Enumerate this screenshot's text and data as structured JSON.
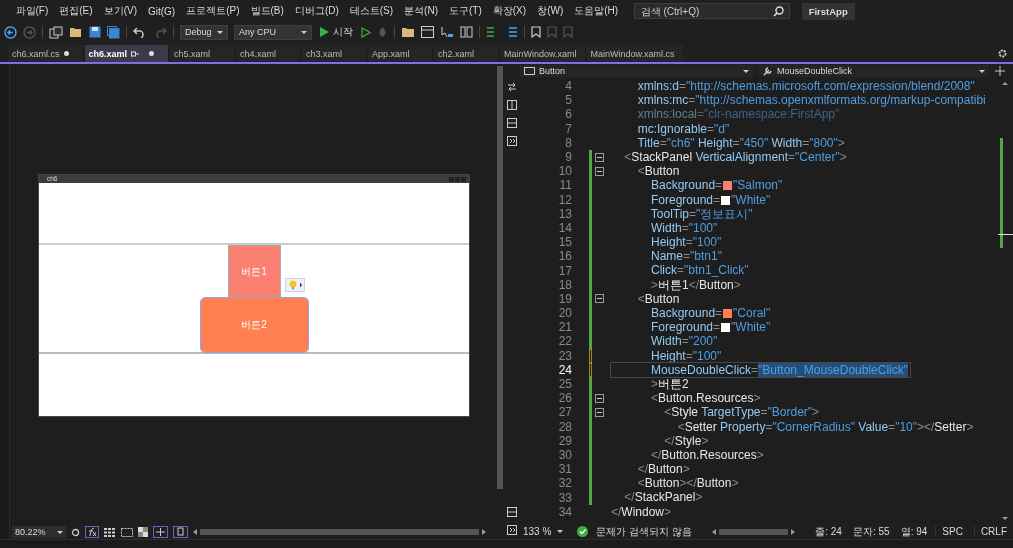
{
  "menu": [
    {
      "label": "파일(F)"
    },
    {
      "label": "편집(E)"
    },
    {
      "label": "보기(V)"
    },
    {
      "label": "Git(G)"
    },
    {
      "label": "프로젝트(P)"
    },
    {
      "label": "빌드(B)"
    },
    {
      "label": "디버그(D)"
    },
    {
      "label": "테스트(S)"
    },
    {
      "label": "분석(N)"
    },
    {
      "label": "도구(T)"
    },
    {
      "label": "확장(X)"
    },
    {
      "label": "창(W)"
    },
    {
      "label": "도움말(H)"
    }
  ],
  "search": {
    "placeholder": "검색 (Ctrl+Q)"
  },
  "solution_name": "FirstApp",
  "toolbar": {
    "configuration": "Debug",
    "platform": "Any CPU",
    "start": "시작"
  },
  "tabs": [
    {
      "label": "ch6.xaml.cs",
      "selected": false,
      "modified": true,
      "pinned": false
    },
    {
      "label": "ch6.xaml",
      "selected": true,
      "modified": true,
      "pinned": true
    },
    {
      "label": "ch5.xaml",
      "selected": false,
      "modified": false,
      "pinned": false
    },
    {
      "label": "ch4.xaml",
      "selected": false,
      "modified": false,
      "pinned": false
    },
    {
      "label": "ch3.xaml",
      "selected": false,
      "modified": false,
      "pinned": false
    },
    {
      "label": "App.xaml",
      "selected": false,
      "modified": false,
      "pinned": false
    },
    {
      "label": "ch2.xaml",
      "selected": false,
      "modified": false,
      "pinned": false
    },
    {
      "label": "MainWindow.xaml",
      "selected": false,
      "modified": false,
      "pinned": false
    },
    {
      "label": "MainWindow.xaml.cs",
      "selected": false,
      "modified": false,
      "pinned": false
    }
  ],
  "designer": {
    "window_title": "ch6",
    "buttons": [
      {
        "label": "버튼1",
        "color": "#fa8072",
        "selected": false
      },
      {
        "label": "버튼2",
        "color": "#ff7f50",
        "selected": true
      }
    ],
    "zoom": "80.22%"
  },
  "editor": {
    "element": "Button",
    "member": "MouseDoubleClick",
    "lines": [
      {
        "num": "4",
        "modified": false,
        "fold": false,
        "current": false,
        "dim": false,
        "tokens": [
          {
            "kind": "attr",
            "text": "        xmlns:d"
          },
          {
            "kind": "punct",
            "text": "="
          },
          {
            "kind": "value",
            "text": "\"http://schemas.microsoft.com/expression/blend/2008\""
          }
        ]
      },
      {
        "num": "5",
        "modified": false,
        "fold": false,
        "current": false,
        "dim": false,
        "tokens": [
          {
            "kind": "attr",
            "text": "        xmlns:mc"
          },
          {
            "kind": "punct",
            "text": "="
          },
          {
            "kind": "value",
            "text": "\"http://schemas.openxmlformats.org/markup-compatibi"
          }
        ]
      },
      {
        "num": "6",
        "modified": false,
        "fold": false,
        "current": false,
        "dim": true,
        "tokens": [
          {
            "kind": "attr",
            "text": "        xmlns:local"
          },
          {
            "kind": "punct",
            "text": "="
          },
          {
            "kind": "value",
            "text": "\"clr-namespace:FirstApp\""
          }
        ]
      },
      {
        "num": "7",
        "modified": false,
        "fold": false,
        "current": false,
        "dim": false,
        "tokens": [
          {
            "kind": "attr",
            "text": "        mc:Ignorable"
          },
          {
            "kind": "punct",
            "text": "="
          },
          {
            "kind": "value",
            "text": "\"d\""
          }
        ]
      },
      {
        "num": "8",
        "modified": false,
        "fold": false,
        "current": false,
        "dim": false,
        "tokens": [
          {
            "kind": "attr",
            "text": "        Title"
          },
          {
            "kind": "punct",
            "text": "="
          },
          {
            "kind": "value",
            "text": "\"ch6\""
          },
          {
            "kind": "attr",
            "text": " Height"
          },
          {
            "kind": "punct",
            "text": "="
          },
          {
            "kind": "value",
            "text": "\"450\""
          },
          {
            "kind": "attr",
            "text": " Width"
          },
          {
            "kind": "punct",
            "text": "="
          },
          {
            "kind": "value",
            "text": "\"800\""
          },
          {
            "kind": "punct",
            "text": ">"
          }
        ]
      },
      {
        "num": "9",
        "modified": true,
        "saved": true,
        "fold": true,
        "current": false,
        "dim": false,
        "tokens": [
          {
            "kind": "punct",
            "text": "    <"
          },
          {
            "kind": "tag",
            "text": "StackPanel"
          },
          {
            "kind": "attr",
            "text": " VerticalAlignment"
          },
          {
            "kind": "punct",
            "text": "="
          },
          {
            "kind": "value",
            "text": "\"Center\""
          },
          {
            "kind": "punct",
            "text": ">"
          }
        ]
      },
      {
        "num": "10",
        "modified": true,
        "saved": true,
        "fold": true,
        "current": false,
        "dim": false,
        "tokens": [
          {
            "kind": "punct",
            "text": "        <"
          },
          {
            "kind": "tag",
            "text": "Button"
          }
        ]
      },
      {
        "num": "11",
        "modified": true,
        "saved": true,
        "fold": false,
        "current": false,
        "dim": false,
        "tokens": [
          {
            "kind": "attr",
            "text": "            Background"
          },
          {
            "kind": "punct",
            "text": "="
          },
          {
            "kind": "swatch",
            "color": "#fa8072"
          },
          {
            "kind": "value",
            "text": "\"Salmon\""
          }
        ]
      },
      {
        "num": "12",
        "modified": true,
        "saved": true,
        "fold": false,
        "current": false,
        "dim": false,
        "tokens": [
          {
            "kind": "attr",
            "text": "            Foreground"
          },
          {
            "kind": "punct",
            "text": "="
          },
          {
            "kind": "swatch",
            "color": "#ffffff"
          },
          {
            "kind": "value",
            "text": "\"White\""
          }
        ]
      },
      {
        "num": "13",
        "modified": true,
        "saved": true,
        "fold": false,
        "current": false,
        "dim": false,
        "tokens": [
          {
            "kind": "attr",
            "text": "            ToolTip"
          },
          {
            "kind": "punct",
            "text": "="
          },
          {
            "kind": "value",
            "text": "\"정보표시\""
          }
        ]
      },
      {
        "num": "14",
        "modified": true,
        "saved": true,
        "fold": false,
        "current": false,
        "dim": false,
        "tokens": [
          {
            "kind": "attr",
            "text": "            Width"
          },
          {
            "kind": "punct",
            "text": "="
          },
          {
            "kind": "value",
            "text": "\"100\""
          }
        ]
      },
      {
        "num": "15",
        "modified": true,
        "saved": true,
        "fold": false,
        "current": false,
        "dim": false,
        "tokens": [
          {
            "kind": "attr",
            "text": "            Height"
          },
          {
            "kind": "punct",
            "text": "="
          },
          {
            "kind": "value",
            "text": "\"100\""
          }
        ]
      },
      {
        "num": "16",
        "modified": true,
        "saved": true,
        "fold": false,
        "current": false,
        "dim": false,
        "tokens": [
          {
            "kind": "attr",
            "text": "            Name"
          },
          {
            "kind": "punct",
            "text": "="
          },
          {
            "kind": "value",
            "text": "\"btn1\""
          }
        ]
      },
      {
        "num": "17",
        "modified": true,
        "saved": true,
        "fold": false,
        "current": false,
        "dim": false,
        "tokens": [
          {
            "kind": "attr",
            "text": "            Click"
          },
          {
            "kind": "punct",
            "text": "="
          },
          {
            "kind": "value",
            "text": "\"btn1_Click\""
          }
        ]
      },
      {
        "num": "18",
        "modified": true,
        "saved": true,
        "fold": false,
        "current": false,
        "dim": false,
        "tokens": [
          {
            "kind": "punct",
            "text": "            >"
          },
          {
            "kind": "content",
            "text": "버튼1"
          },
          {
            "kind": "punct",
            "text": "</"
          },
          {
            "kind": "tag",
            "text": "Button"
          },
          {
            "kind": "punct",
            "text": ">"
          }
        ]
      },
      {
        "num": "19",
        "modified": true,
        "saved": true,
        "fold": true,
        "current": false,
        "dim": false,
        "tokens": [
          {
            "kind": "punct",
            "text": "        <"
          },
          {
            "kind": "tag",
            "text": "Button"
          }
        ]
      },
      {
        "num": "20",
        "modified": true,
        "saved": true,
        "fold": false,
        "current": false,
        "dim": false,
        "tokens": [
          {
            "kind": "attr",
            "text": "            Background"
          },
          {
            "kind": "punct",
            "text": "="
          },
          {
            "kind": "swatch",
            "color": "#ff7f50"
          },
          {
            "kind": "value",
            "text": "\"Coral\""
          }
        ]
      },
      {
        "num": "21",
        "modified": true,
        "saved": true,
        "fold": false,
        "current": false,
        "dim": false,
        "tokens": [
          {
            "kind": "attr",
            "text": "            Foreground"
          },
          {
            "kind": "punct",
            "text": "="
          },
          {
            "kind": "swatch",
            "color": "#ffffff"
          },
          {
            "kind": "value",
            "text": "\"White\""
          }
        ]
      },
      {
        "num": "22",
        "modified": true,
        "saved": true,
        "fold": false,
        "current": false,
        "dim": false,
        "tokens": [
          {
            "kind": "attr",
            "text": "            Width"
          },
          {
            "kind": "punct",
            "text": "="
          },
          {
            "kind": "value",
            "text": "\"200\""
          }
        ]
      },
      {
        "num": "23",
        "modified": true,
        "saved": false,
        "fold": false,
        "current": false,
        "dim": false,
        "tokens": [
          {
            "kind": "attr",
            "text": "            Height"
          },
          {
            "kind": "punct",
            "text": "="
          },
          {
            "kind": "value",
            "text": "\"100\""
          }
        ]
      },
      {
        "num": "24",
        "modified": true,
        "saved": false,
        "fold": false,
        "current": true,
        "dim": false,
        "tokens": [
          {
            "kind": "attr",
            "text": "            MouseDoubleClick"
          },
          {
            "kind": "punct",
            "text": "="
          },
          {
            "kind": "selected",
            "text": "\"Button_MouseDoubleClick\""
          }
        ]
      },
      {
        "num": "25",
        "modified": true,
        "saved": true,
        "fold": false,
        "current": false,
        "dim": false,
        "tokens": [
          {
            "kind": "punct",
            "text": "            >"
          },
          {
            "kind": "content",
            "text": "버튼2"
          }
        ]
      },
      {
        "num": "26",
        "modified": true,
        "saved": true,
        "fold": true,
        "current": false,
        "dim": false,
        "tokens": [
          {
            "kind": "punct",
            "text": "            <"
          },
          {
            "kind": "tag",
            "text": "Button.Resources"
          },
          {
            "kind": "punct",
            "text": ">"
          }
        ]
      },
      {
        "num": "27",
        "modified": true,
        "saved": true,
        "fold": true,
        "current": false,
        "dim": false,
        "tokens": [
          {
            "kind": "punct",
            "text": "                <"
          },
          {
            "kind": "tag",
            "text": "Style"
          },
          {
            "kind": "attr",
            "text": " TargetType"
          },
          {
            "kind": "punct",
            "text": "="
          },
          {
            "kind": "value",
            "text": "\"Border\""
          },
          {
            "kind": "punct",
            "text": ">"
          }
        ]
      },
      {
        "num": "28",
        "modified": true,
        "saved": true,
        "fold": false,
        "current": false,
        "dim": false,
        "tokens": [
          {
            "kind": "punct",
            "text": "                    <"
          },
          {
            "kind": "tag",
            "text": "Setter"
          },
          {
            "kind": "attr",
            "text": " Property"
          },
          {
            "kind": "punct",
            "text": "="
          },
          {
            "kind": "value",
            "text": "\"CornerRadius\""
          },
          {
            "kind": "attr",
            "text": " Value"
          },
          {
            "kind": "punct",
            "text": "="
          },
          {
            "kind": "value",
            "text": "\"10\""
          },
          {
            "kind": "punct",
            "text": "></"
          },
          {
            "kind": "tag",
            "text": "Setter"
          },
          {
            "kind": "punct",
            "text": ">"
          }
        ]
      },
      {
        "num": "29",
        "modified": true,
        "saved": true,
        "fold": false,
        "current": false,
        "dim": false,
        "tokens": [
          {
            "kind": "punct",
            "text": "                </"
          },
          {
            "kind": "tag",
            "text": "Style"
          },
          {
            "kind": "punct",
            "text": ">"
          }
        ]
      },
      {
        "num": "30",
        "modified": true,
        "saved": true,
        "fold": false,
        "current": false,
        "dim": false,
        "tokens": [
          {
            "kind": "punct",
            "text": "            </"
          },
          {
            "kind": "tag",
            "text": "Button.Resources"
          },
          {
            "kind": "punct",
            "text": ">"
          }
        ]
      },
      {
        "num": "31",
        "modified": true,
        "saved": true,
        "fold": false,
        "current": false,
        "dim": false,
        "tokens": [
          {
            "kind": "punct",
            "text": "        </"
          },
          {
            "kind": "tag",
            "text": "Button"
          },
          {
            "kind": "punct",
            "text": ">"
          }
        ]
      },
      {
        "num": "32",
        "modified": true,
        "saved": true,
        "fold": false,
        "current": false,
        "dim": false,
        "tokens": [
          {
            "kind": "punct",
            "text": "        <"
          },
          {
            "kind": "tag",
            "text": "Button"
          },
          {
            "kind": "punct",
            "text": "></"
          },
          {
            "kind": "tag",
            "text": "Button"
          },
          {
            "kind": "punct",
            "text": ">"
          }
        ]
      },
      {
        "num": "33",
        "modified": true,
        "saved": true,
        "fold": false,
        "current": false,
        "dim": false,
        "tokens": [
          {
            "kind": "punct",
            "text": "    </"
          },
          {
            "kind": "tag",
            "text": "StackPanel"
          },
          {
            "kind": "punct",
            "text": ">"
          }
        ]
      },
      {
        "num": "34",
        "modified": false,
        "fold": false,
        "current": false,
        "dim": false,
        "tokens": [
          {
            "kind": "punct",
            "text": "</"
          },
          {
            "kind": "tag",
            "text": "Window"
          },
          {
            "kind": "punct",
            "text": ">"
          }
        ]
      }
    ]
  },
  "status": {
    "zoom": "133 %",
    "issues": "문제가 검색되지 않음",
    "line": "줄: 24",
    "char": "문자: 55",
    "col": "열: 94",
    "whitespace": "SPC",
    "eol": "CRLF"
  }
}
